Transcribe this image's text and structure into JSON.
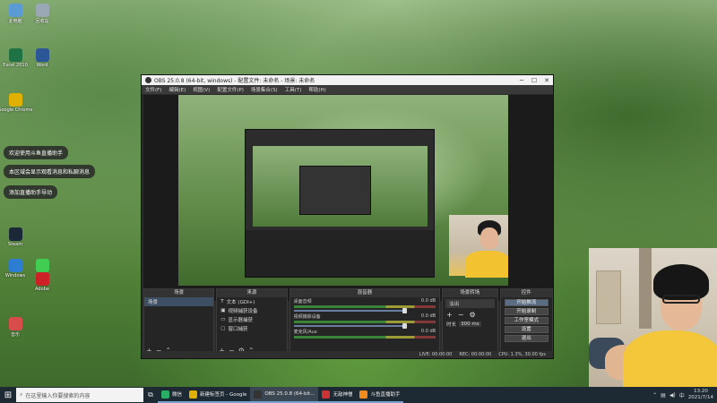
{
  "desktop": {
    "icons": [
      {
        "label": "此电脑",
        "icon": "computer-icon",
        "color": "#5b9bd5"
      },
      {
        "label": "回收站",
        "icon": "recycle-bin-icon",
        "color": "#9aa7b4"
      },
      {
        "label": "Excel 2010",
        "icon": "excel-icon",
        "color": "#1f7244"
      },
      {
        "label": "Word",
        "icon": "word-icon",
        "color": "#2b5797"
      },
      {
        "label": "Google Chrome",
        "icon": "chrome-icon",
        "color": "#e0b000"
      },
      {
        "label": "Steam",
        "icon": "steam-icon",
        "color": "#1b2838"
      },
      {
        "label": "Windows",
        "icon": "windows-icon",
        "color": "#2d7dd2"
      },
      {
        "label": "Qt",
        "icon": "qt-icon",
        "color": "#41cd52"
      },
      {
        "label": "Adobe",
        "icon": "adobe-icon",
        "color": "#cc2127"
      },
      {
        "label": "音乐",
        "icon": "music-icon",
        "color": "#d94c4c"
      }
    ],
    "toasts": [
      "欢迎使用斗鱼直播助手",
      "本区域会显示观看消息和私聊消息",
      "添加直播助手导动"
    ]
  },
  "obs": {
    "title": "OBS 25.0.8 (64-bit, windows) - 配置文件: 未命名 - 场景: 未命名",
    "menu": [
      "文件(F)",
      "编辑(E)",
      "视图(V)",
      "配置文件(P)",
      "场景集合(S)",
      "工具(T)",
      "帮助(H)"
    ],
    "docks": {
      "scenes": {
        "title": "场景",
        "items": [
          "场景"
        ]
      },
      "sources": {
        "title": "来源",
        "items": [
          "文本 (GDI+)",
          "视频捕获设备",
          "显示器捕获",
          "窗口捕获"
        ]
      },
      "mixer": {
        "title": "混音器",
        "channels": [
          {
            "name": "桌面音频",
            "db": "0.0 dB"
          },
          {
            "name": "视频捕获设备",
            "db": "0.0 dB"
          },
          {
            "name": "麦克风/Aux",
            "db": "0.0 dB"
          }
        ]
      },
      "transitions": {
        "title": "场景转场",
        "type": "淡出",
        "duration_label": "时长",
        "duration": "300 ms"
      },
      "controls": {
        "title": "控件",
        "buttons": [
          "开始推流",
          "开始录制",
          "工作室模式",
          "设置",
          "退出"
        ]
      }
    },
    "status": {
      "live": "LIVE: 00:00:00",
      "rec": "REC: 00:00:00",
      "cpu": "CPU: 1.3%, 30.00 fps"
    }
  },
  "taskbar": {
    "search_placeholder": "在这里输入你要搜索的内容",
    "apps": [
      {
        "label": "微信",
        "color": "#2aae67"
      },
      {
        "label": "新建标签页 - Google",
        "color": "#e0b000"
      },
      {
        "label": "OBS 25.0.8 (64-bit...",
        "color": "#333333"
      },
      {
        "label": "无敌神僧",
        "color": "#cc3333"
      },
      {
        "label": "斗鱼直播助手",
        "color": "#f08c1e"
      }
    ],
    "time": "13:20",
    "date": "2021/7/14"
  }
}
